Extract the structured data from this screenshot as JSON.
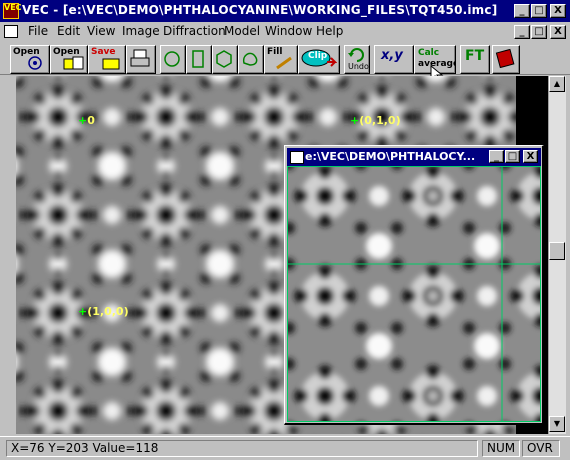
{
  "window": {
    "title": "VEC - [e:\\VEC\\DEMO\\PHTHALOCYANINE\\WORKING_FILES\\TQT450.imc]",
    "icon_text": "VEC",
    "controls": [
      "_",
      "□",
      "X"
    ],
    "mdi_controls": [
      "_",
      "□",
      "X"
    ]
  },
  "menu": [
    "File",
    "Edit",
    "View",
    "Image",
    "Diffraction",
    "Model",
    "Window",
    "Help"
  ],
  "toolbar": {
    "open1": "Open",
    "open2": "Open",
    "save": "Save",
    "fill": "Fill",
    "clip": "Clip",
    "undo": "Undo",
    "xy": "x,y",
    "calc_top": "Calc",
    "calc_bottom": "average",
    "ft": "FT"
  },
  "image": {
    "labels": [
      {
        "text": "0"
      },
      {
        "text": "(0,1,0)"
      },
      {
        "text": "(1,0,0)"
      }
    ]
  },
  "child_window": {
    "title": "e:\\VEC\\DEMO\\PHTHALOCY..."
  },
  "status": {
    "coords": "X=76 Y=203 Value=118",
    "num": "NUM",
    "ovr": "OVR"
  },
  "colors": {
    "title_bg": "#000080",
    "face": "#c0c0c0",
    "lattice_label": "#ffff66",
    "lattice_marker": "#00ff00",
    "grid_line": "#00cc66"
  }
}
